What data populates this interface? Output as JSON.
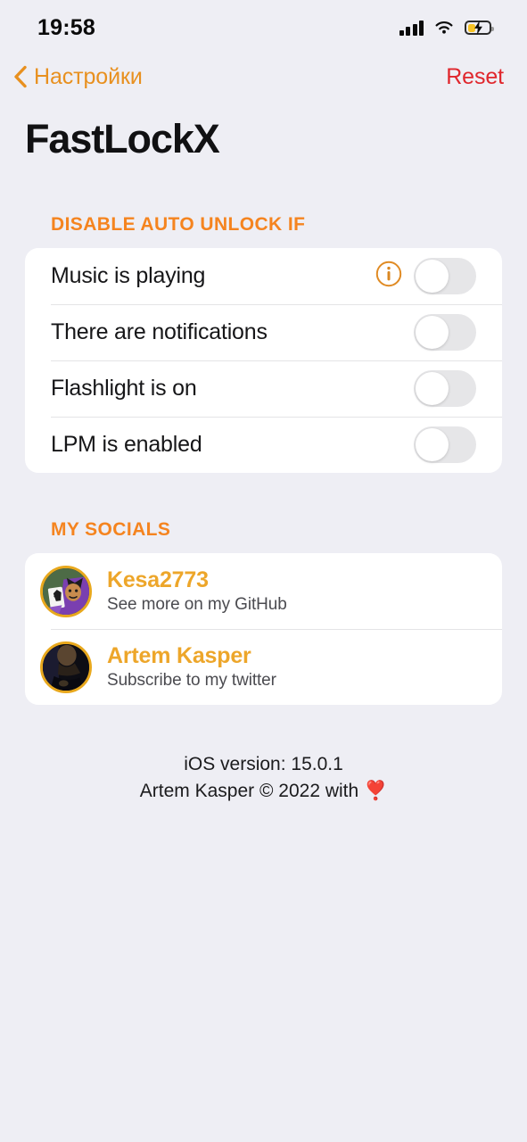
{
  "status_bar": {
    "time": "19:58",
    "signal_icon": "cellular-signal-icon",
    "wifi_icon": "wifi-icon",
    "battery_icon": "battery-charging-icon",
    "battery_color": "#f7c325"
  },
  "nav": {
    "back_label": "Настройки",
    "back_icon": "chevron-left-icon",
    "reset_label": "Reset",
    "reset_color": "#e0262c",
    "tint_color": "#e8901f"
  },
  "page_title": "FastLockX",
  "sections": [
    {
      "header": "DISABLE AUTO UNLOCK IF",
      "header_color": "#f5841f",
      "rows": [
        {
          "label": "Music is playing",
          "has_info": true,
          "info_icon": "info-circle-icon",
          "toggle": "off"
        },
        {
          "label": "There are notifications",
          "has_info": false,
          "toggle": "off"
        },
        {
          "label": "Flashlight is on",
          "has_info": false,
          "toggle": "off"
        },
        {
          "label": "LPM is enabled",
          "has_info": false,
          "toggle": "off"
        }
      ]
    },
    {
      "header": "MY SOCIALS",
      "header_color": "#f5841f",
      "socials": [
        {
          "title": "Kesa2773",
          "subtitle": "See more on my GitHub",
          "avatar_icon": "avatar-joker-illustration"
        },
        {
          "title": "Artem Kasper",
          "subtitle": "Subscribe to my twitter",
          "avatar_icon": "avatar-portrait-photo"
        }
      ]
    }
  ],
  "footer": {
    "line1": "iOS version: 15.0.1",
    "line2": "Artem Kasper © 2022 with",
    "emoji": "❣️"
  }
}
